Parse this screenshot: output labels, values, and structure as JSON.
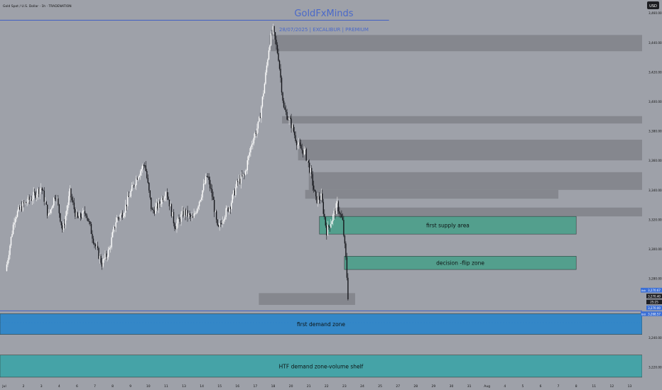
{
  "header": {
    "symbol_title": "Gold Spot / U.S. Dollar · 1h · TRADENATION",
    "currency_badge": "USD",
    "watermark_title": "GoldFxMinds",
    "watermark_subtitle": "28/07/2025 | EXCALIBUR | PREMIUM"
  },
  "colors": {
    "background": "#9ea1a9",
    "candle_up": "#ffffff",
    "candle_down": "#15161b",
    "supply_zone": "#4f9f8c",
    "demand_zone": "#2f86c9",
    "htf_zone": "#41a4a7",
    "shaded_zone": "#7c7f86",
    "structure_line": "#3557c7",
    "price_tag_blue": "#3b6fd6"
  },
  "chart_data": {
    "type": "candlestick",
    "title": "Gold Spot / U.S. Dollar · 1h · TRADENATION",
    "xlabel": "",
    "ylabel": "",
    "xlim": [
      1,
      20.2
    ],
    "x_axis_note": "x values are July 2025 calendar days; 32 and beyond continue into August",
    "ylim": [
      3212,
      3462
    ],
    "grid": false,
    "x_ticks": [
      {
        "x": 1,
        "label": "Jul"
      },
      {
        "x": 2,
        "label": "2"
      },
      {
        "x": 3,
        "label": "3"
      },
      {
        "x": 4,
        "label": "4"
      },
      {
        "x": 5,
        "label": "6"
      },
      {
        "x": 6,
        "label": "7"
      },
      {
        "x": 7,
        "label": "8"
      },
      {
        "x": 8,
        "label": "9"
      },
      {
        "x": 9,
        "label": "10"
      },
      {
        "x": 10,
        "label": "11"
      },
      {
        "x": 11,
        "label": "13"
      },
      {
        "x": 12,
        "label": "14"
      },
      {
        "x": 13,
        "label": "15"
      },
      {
        "x": 14,
        "label": "16"
      },
      {
        "x": 15,
        "label": "17"
      },
      {
        "x": 16,
        "label": "18"
      },
      {
        "x": 17,
        "label": "20"
      },
      {
        "x": 18,
        "label": "21"
      },
      {
        "x": 19,
        "label": "22"
      },
      {
        "x": 20,
        "label": "23"
      },
      {
        "x": 21,
        "label": "24"
      },
      {
        "x": 22,
        "label": "25"
      },
      {
        "x": 23,
        "label": "27"
      },
      {
        "x": 24,
        "label": "28"
      },
      {
        "x": 25,
        "label": "29"
      },
      {
        "x": 26,
        "label": "30"
      },
      {
        "x": 27,
        "label": "31"
      },
      {
        "x": 28,
        "label": "Aug"
      },
      {
        "x": 29,
        "label": "4"
      },
      {
        "x": 30,
        "label": "5"
      },
      {
        "x": 31,
        "label": "6"
      },
      {
        "x": 32,
        "label": "7"
      },
      {
        "x": 33,
        "label": "8"
      },
      {
        "x": 34,
        "label": "11"
      },
      {
        "x": 35,
        "label": "12"
      },
      {
        "x": 36,
        "label": "13"
      },
      {
        "x": 37,
        "label": "14"
      },
      {
        "x": 38,
        "label": "15"
      },
      {
        "x": 39,
        "label": "18"
      },
      {
        "x": 40,
        "label": "19"
      },
      {
        "x": 41,
        "label": "20"
      }
    ],
    "y_ticks": [
      3460,
      3440,
      3420,
      3400,
      3380,
      3360,
      3340,
      3320,
      3300,
      3280,
      3260,
      3240,
      3220
    ],
    "y_tick_labels": [
      "3,460.00",
      "3,440.00",
      "3,420.00",
      "3,400.00",
      "3,380.00",
      "3,360.00",
      "3,340.00",
      "3,320.00",
      "3,300.00",
      "3,280.00",
      "3,260.00",
      "3,240.00",
      "3,220.00"
    ],
    "price_path": [
      [
        1.0,
        3285
      ],
      [
        1.5,
        3322
      ],
      [
        2.0,
        3330
      ],
      [
        2.5,
        3335
      ],
      [
        3.0,
        3342
      ],
      [
        3.4,
        3322
      ],
      [
        3.8,
        3338
      ],
      [
        4.2,
        3312
      ],
      [
        4.6,
        3338
      ],
      [
        5.0,
        3320
      ],
      [
        5.5,
        3325
      ],
      [
        6.0,
        3303
      ],
      [
        6.4,
        3290
      ],
      [
        6.8,
        3299
      ],
      [
        7.2,
        3320
      ],
      [
        7.6,
        3325
      ],
      [
        8.0,
        3338
      ],
      [
        8.4,
        3350
      ],
      [
        8.8,
        3358
      ],
      [
        9.2,
        3325
      ],
      [
        9.6,
        3330
      ],
      [
        10.0,
        3340
      ],
      [
        10.5,
        3315
      ],
      [
        11.0,
        3325
      ],
      [
        11.5,
        3320
      ],
      [
        12.0,
        3338
      ],
      [
        12.3,
        3350
      ],
      [
        12.6,
        3335
      ],
      [
        12.9,
        3312
      ],
      [
        13.2,
        3322
      ],
      [
        13.6,
        3330
      ],
      [
        14.0,
        3345
      ],
      [
        14.4,
        3350
      ],
      [
        14.8,
        3372
      ],
      [
        15.2,
        3385
      ],
      [
        15.5,
        3410
      ],
      [
        15.8,
        3440
      ],
      [
        16.0,
        3448
      ],
      [
        16.3,
        3430
      ],
      [
        16.6,
        3395
      ],
      [
        17.0,
        3385
      ],
      [
        17.4,
        3370
      ],
      [
        17.8,
        3365
      ],
      [
        18.1,
        3352
      ],
      [
        18.4,
        3333
      ],
      [
        18.7,
        3335
      ],
      [
        19.0,
        3312
      ],
      [
        19.3,
        3320
      ],
      [
        19.6,
        3330
      ],
      [
        19.9,
        3318
      ],
      [
        20.1,
        3290
      ],
      [
        20.2,
        3268
      ]
    ],
    "annotations": [
      {
        "label": "first supply area",
        "y_range": [
          3310,
          3322
        ],
        "x_range": [
          18.6,
          33.0
        ],
        "kind": "supply"
      },
      {
        "label": "decision -flip zone",
        "y_range": [
          3286,
          3295
        ],
        "x_range": [
          20.0,
          33.0
        ],
        "kind": "flip"
      },
      {
        "label": "first demand zone",
        "y_range": [
          3242,
          3256
        ],
        "x_range": [
          1,
          41
        ],
        "kind": "demand"
      },
      {
        "label": "HTF demand zone-volume shelf",
        "y_range": [
          3213,
          3228
        ],
        "x_range": [
          1,
          41
        ],
        "kind": "htf"
      }
    ],
    "shaded_zones": [
      {
        "y_range": [
          3434,
          3445
        ],
        "x_range": [
          15.8,
          41
        ]
      },
      {
        "y_range": [
          3385,
          3390
        ],
        "x_range": [
          16.5,
          41
        ]
      },
      {
        "y_range": [
          3360,
          3374
        ],
        "x_range": [
          17.4,
          41
        ]
      },
      {
        "y_range": [
          3340,
          3352
        ],
        "x_range": [
          18.0,
          41
        ]
      },
      {
        "y_range": [
          3334,
          3340
        ],
        "x_range": [
          17.8,
          32.0
        ]
      },
      {
        "y_range": [
          3322,
          3328
        ],
        "x_range": [
          19.5,
          41
        ]
      },
      {
        "y_range": [
          3262,
          3270
        ],
        "x_range": [
          15.2,
          20.6
        ]
      }
    ],
    "horizontal_levels": [
      {
        "y": 3455,
        "x_range": [
          1,
          22.5
        ],
        "style": "solid"
      },
      {
        "y": 3258,
        "x_range": [
          1,
          41
        ],
        "style": "solid"
      },
      {
        "y": 3250,
        "x_range": [
          1,
          41
        ],
        "style": "dotted"
      }
    ],
    "price_tags": [
      {
        "label": "3,270.67",
        "y": 3272,
        "color": "#3b6fd6"
      },
      {
        "label": "3,270.40",
        "y": 3268,
        "color": "#1e1f24"
      },
      {
        "label": "25:25",
        "y": 3264,
        "color": "#1e1f24"
      },
      {
        "label": "3,270.00",
        "y": 3260,
        "color": "#3b6fd6"
      },
      {
        "label": "3,268.57",
        "y": 3256,
        "color": "#3b6fd6"
      }
    ],
    "price_tag_prefixes": [
      "Ask",
      "Bid"
    ]
  }
}
